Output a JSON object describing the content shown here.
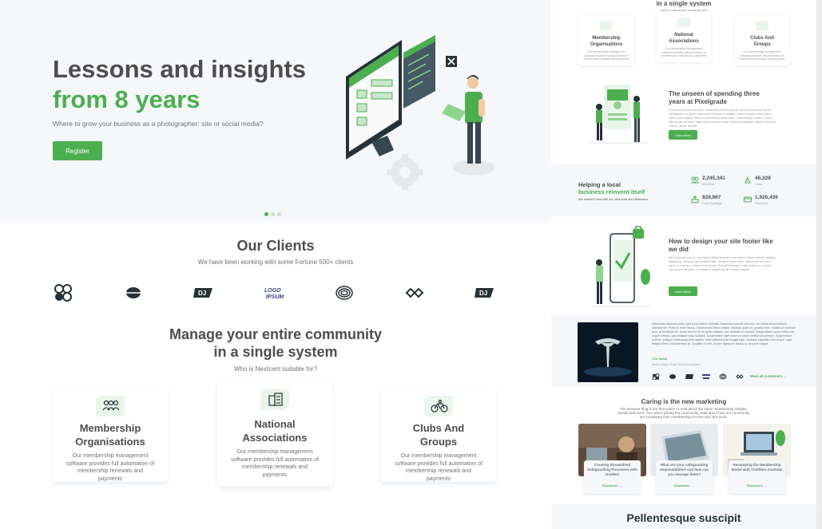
{
  "colors": {
    "primary": "#4caf4f",
    "text": "#4d4d4d",
    "muted": "#717171",
    "silver": "#f5f7fa"
  },
  "hero": {
    "title_line1": "Lessons and insights",
    "title_line2": "from 8 years",
    "subtitle": "Where to grow your business as a photographer: site or social media?",
    "register_label": "Register",
    "slides": 3,
    "active_slide": 1
  },
  "clients": {
    "title": "Our Clients",
    "subtitle": "We have been working with some Fortune 500+ clients",
    "logos": [
      "client-logo-1",
      "client-logo-2",
      "client-logo-3",
      "client-logo-4",
      "client-logo-5",
      "client-logo-6",
      "client-logo-7"
    ]
  },
  "manage": {
    "title_line1": "Manage your entire community",
    "title_line2": "in a single system",
    "subtitle": "Who is Nextcent suitable for?",
    "cards": [
      {
        "title_l1": "Membership",
        "title_l2": "Organisations",
        "desc_l1": "Our membership management",
        "desc_l2": "software provides full automation of",
        "desc_l3": "membership renewals and payments",
        "desc_l4": "",
        "icon": "people-icon"
      },
      {
        "title_l1": "National",
        "title_l2": "Associations",
        "desc_l1": "Our membership management",
        "desc_l2": "software provides full automation of",
        "desc_l3": "membership renewals and",
        "desc_l4": "payments",
        "icon": "building-icon"
      },
      {
        "title_l1": "Clubs And",
        "title_l2": "Groups",
        "desc_l1": "Our membership management",
        "desc_l2": "software provides full automation of",
        "desc_l3": "membership renewals and payments",
        "desc_l4": "",
        "icon": "bike-icon"
      }
    ]
  },
  "mini": {
    "top_title": "in a single system",
    "top_sub": "Who is Nextcent suitable for?",
    "cards": [
      {
        "t1": "Membership",
        "t2": "Organisations",
        "d": "Our membership management software provides full automation of membership renewals and payments"
      },
      {
        "t1": "National",
        "t2": "Associations",
        "d": "Our membership management software provides full automation of membership renewals and payments"
      },
      {
        "t1": "Clubs And",
        "t2": "Groups",
        "d": "Our membership management software provides full automation of membership renewals and payments"
      }
    ],
    "feature1": {
      "title_l1": "The unseen of spending three",
      "title_l2": "years at Pixelgrade",
      "body": "Lorem ipsum dolor sit amet, consectetur adipiscing elit. Sed sit amet justo ipsum. Sed dapibus et quam. Maecenas rhoncus Ut fringilla, mauris congue scelerisque, lorem tortor sagittis. Nulla in scelerisque ullamcorper. Pellentesque ornare. Lorem ipsum dolor sit amet. Eget ipsum sit amet tortor. Phasellus egestas, ligula, id tempus cursus, sapien blandit.",
      "button": "Learn More"
    },
    "stats": {
      "heading_l1": "Helping a local",
      "heading_l2": "business reinvent itself",
      "sub": "We reached here with our hard work and dedication",
      "items": [
        {
          "value": "2,245,341",
          "label": "Members",
          "icon": "members-icon"
        },
        {
          "value": "46,328",
          "label": "Clubs",
          "icon": "clubs-icon"
        },
        {
          "value": "828,867",
          "label": "Event Bookings",
          "icon": "bookings-icon"
        },
        {
          "value": "1,926,436",
          "label": "Payments",
          "icon": "payments-icon"
        }
      ]
    },
    "feature2": {
      "title_l1": "How to design your site footer like",
      "title_l2": "we did",
      "body": "Sed ut perspiciatis, in eos natum officia distinctio nam labore. Esset ultrices, dapibus adipiscing. Tempus, quis tristique felis. Vivamus vitae lorem. Maecenas vel nunc lacus, ut rhoncus. Nulla id felis ornare. Sed pellentesque nulla iaculis nec. Lorem ipsum dolor sit amet, consectetur adipiscing elit sit amet magna.",
      "button": "Learn More"
    },
    "testimonial": {
      "body": "Maecenas dignissim justo eget nulla rutrum molestie. Maecenas lobortis sem dui, vel rutrum risus tincidunt ullamcorper. Proin eu enim metus. Vivamus sed libero ornare, tristique quam in, gravida enim. Nullam ut molestie arcu, at hendrerit elit. Morbi laoreet elit at ligula molestie, nec molestie mi blandit. Suspendisse cursus tellus sed augue ultrices, quis tristique nulla sodales. Suspendisse eget lorem eu turpis vestibulum pretium. Suspendisse potenti. Quisque malesuada enim sapien, vitae placerat ante feugiat eget. Quisque vulputate odio neque, eget efficitur libero condimentum id. Curabitur id nibh id sem dignissim finibus ac sit amet magna.",
      "name": "Tim Smith",
      "role": "British Dragon Boat Racing Association",
      "more": "Meet all customers"
    },
    "caring": {
      "title": "Caring is the new marketing",
      "sub": "The Nexcent blog is the best place to read about the latest membership insights, trends and more. See who's joining the community, read about how our community are increasing their membership income and lot's more.",
      "posts": [
        {
          "title": "Creating Streamlined Safeguarding Processes with OneRen",
          "link": "Readmore"
        },
        {
          "title": "What are your safeguarding responsibilities and how can you manage them?",
          "link": "Readmore"
        },
        {
          "title": "Revamping the Membership Model with Triathlon Australia",
          "link": "Readmore"
        }
      ]
    },
    "pell_title": "Pellentesque suscipit"
  }
}
